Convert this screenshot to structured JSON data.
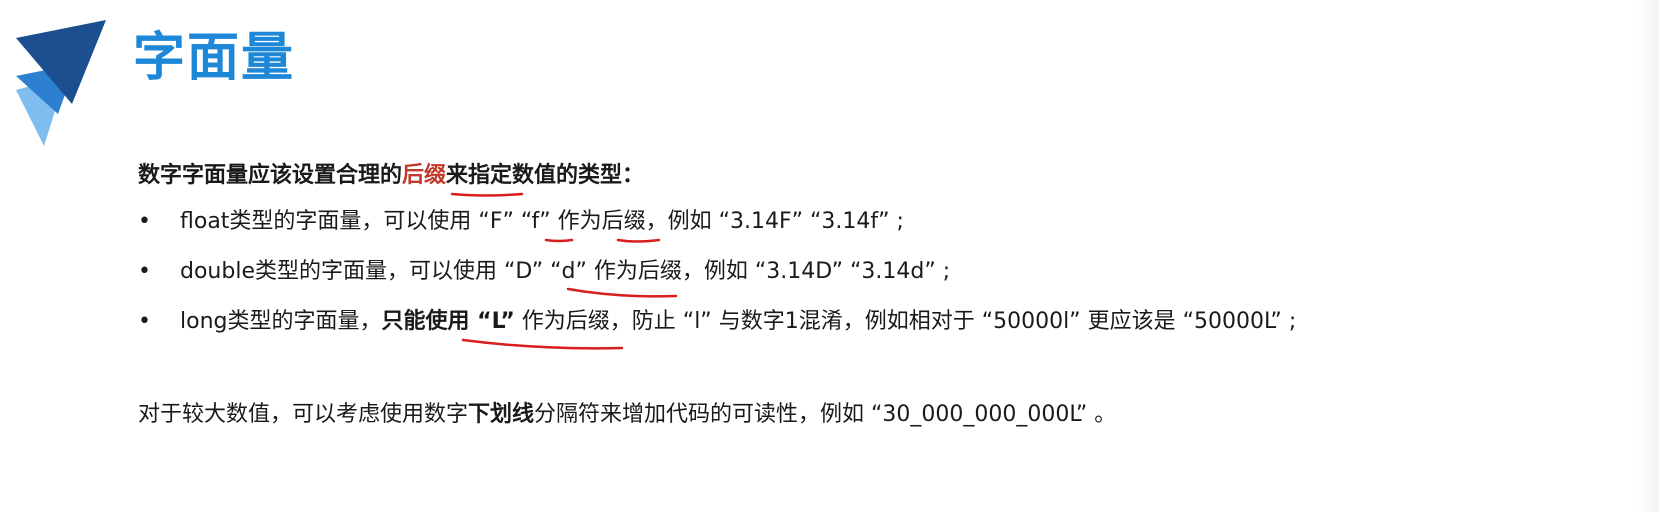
{
  "title": "字面量",
  "intro": {
    "prefix": "数字字面量应该设置合理的",
    "highlight": "后缀",
    "suffix": "来指定数值的类型："
  },
  "bullets": [
    {
      "marker": "•",
      "text": "float类型的字面量，可以使用 “F” “f” 作为后缀，例如 “3.14F” “3.14f” ;"
    },
    {
      "marker": "•",
      "text": "double类型的字面量，可以使用 “D” “d” 作为后缀，例如 “3.14D” “3.14d” ;"
    },
    {
      "marker": "•",
      "text_before": "long类型的字面量，",
      "text_strong": "只能使用 “L”",
      "text_after": " 作为后缀，防止 “l” 与数字1混淆，例如相对于 “50000l” 更应该是 “50000L” ;"
    }
  ],
  "note": {
    "prefix": "对于较大数值，可以考虑使用数字",
    "strong": "下划线",
    "suffix": "分隔符来增加代码的可读性，例如 “30_000_000_000L” 。"
  },
  "colors": {
    "title": "#1e88d8",
    "highlight": "#c0392b",
    "annotation": "#d81e1e",
    "logo_dark": "#1c4f8f",
    "logo_mid": "#2d7fd0",
    "logo_light": "#7fbdf0"
  }
}
